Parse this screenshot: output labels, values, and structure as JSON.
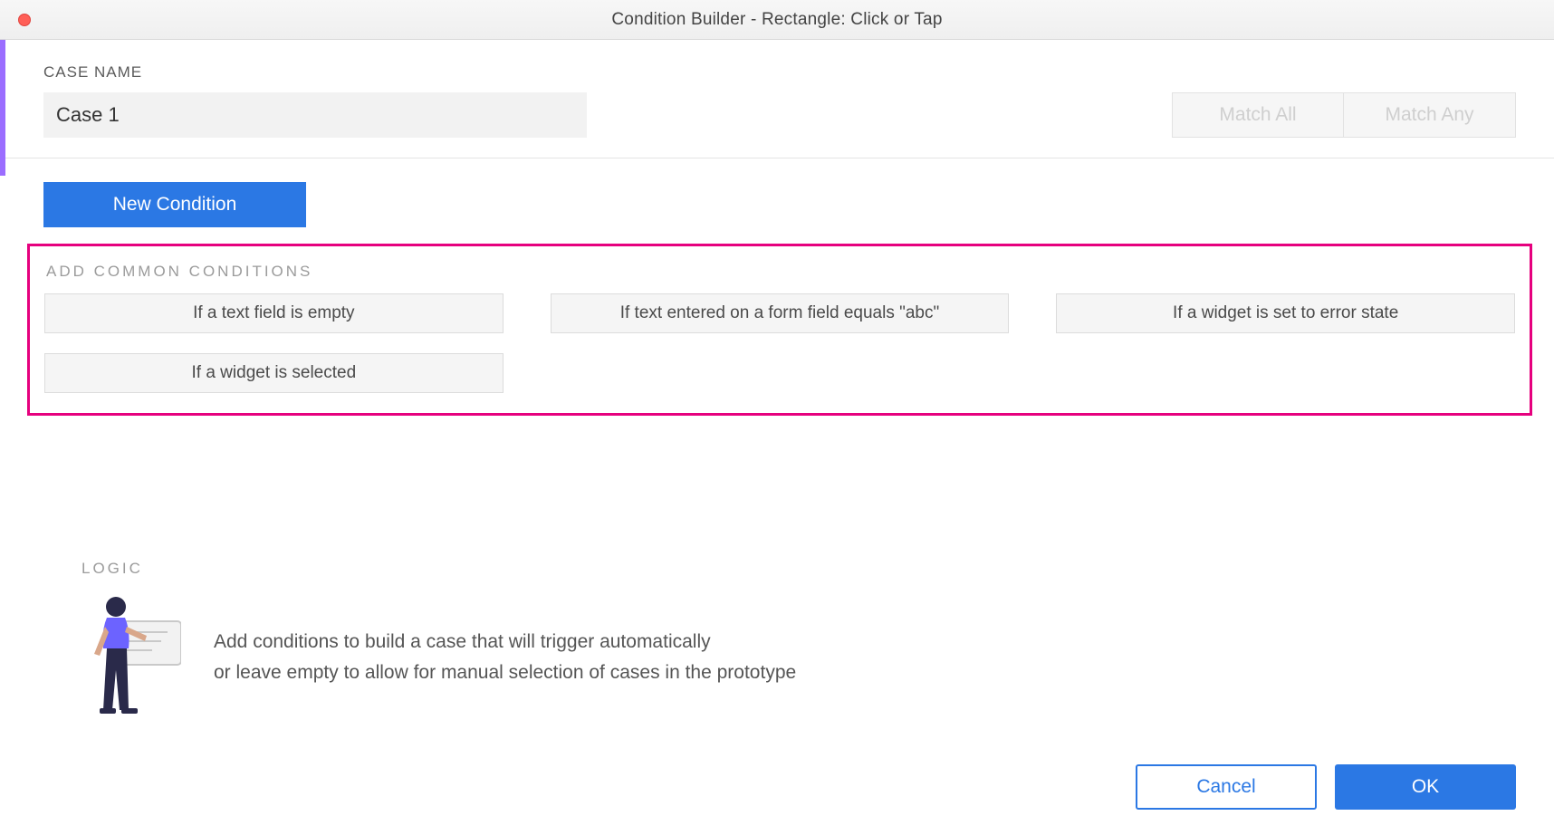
{
  "titlebar": {
    "title": "Condition Builder   -   Rectangle: Click or Tap"
  },
  "case": {
    "label": "CASE NAME",
    "value": "Case 1",
    "match_all": "Match All",
    "match_any": "Match Any"
  },
  "new_condition_label": "New Condition",
  "common": {
    "heading": "ADD COMMON CONDITIONS",
    "items": [
      "If a text field is empty",
      "If text entered on a form field equals \"abc\"",
      "If a widget is set to error state",
      "If a widget is selected"
    ]
  },
  "logic": {
    "heading": "LOGIC",
    "line1": "Add conditions to build a case that will trigger automatically",
    "line2": "or leave empty to allow for manual selection of cases in the prototype"
  },
  "footer": {
    "cancel": "Cancel",
    "ok": "OK"
  }
}
